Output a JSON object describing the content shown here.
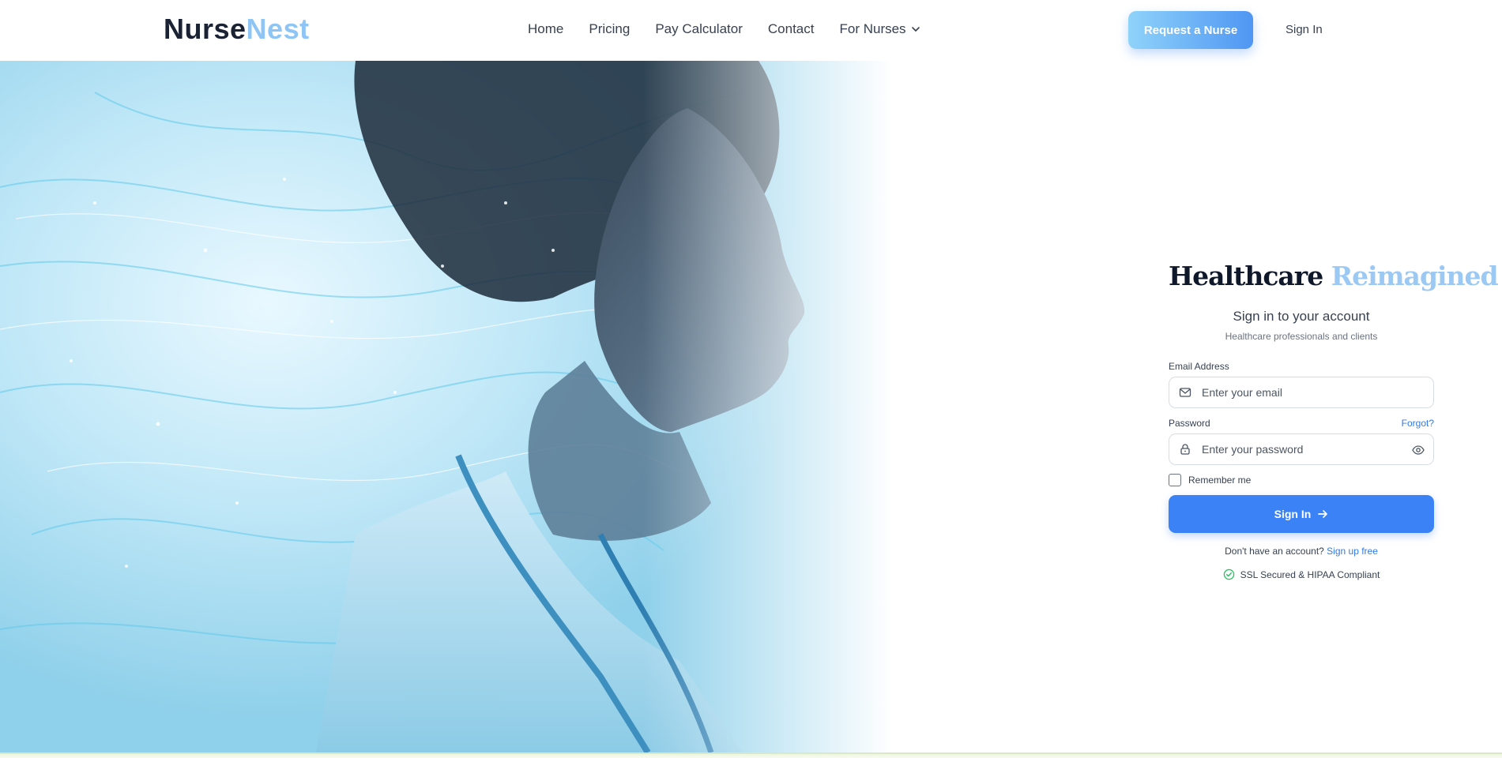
{
  "header": {
    "logo_part1": "Nurse",
    "logo_part2": "Nest",
    "nav": {
      "home": "Home",
      "pricing": "Pricing",
      "pay_calculator": "Pay Calculator",
      "contact": "Contact",
      "for_nurses": "For Nurses"
    },
    "cta_label": "Request a Nurse",
    "signin_label": "Sign In"
  },
  "login": {
    "headline_part1": "Healthcare",
    "headline_part2": "Reimagined",
    "title": "Sign in to your account",
    "subtitle": "Healthcare professionals and clients",
    "email_label": "Email Address",
    "email_placeholder": "Enter your email",
    "password_label": "Password",
    "forgot_label": "Forgot?",
    "password_placeholder": "Enter your password",
    "remember_label": "Remember me",
    "submit_label": "Sign In",
    "no_account_text": "Don't have an account?",
    "signup_label": "Sign up free",
    "security_text": "SSL Secured & HIPAA Compliant"
  },
  "colors": {
    "primary": "#3b82f6",
    "logo_accent": "#8fc5f5",
    "headline_accent": "#9bc9f4",
    "secure_green": "#22c55e"
  },
  "icons": {
    "email": "mail-icon",
    "password": "lock-icon",
    "toggle": "eye-icon",
    "submit": "arrow-right-icon",
    "security": "check-circle-icon",
    "dropdown": "chevron-down-icon"
  }
}
